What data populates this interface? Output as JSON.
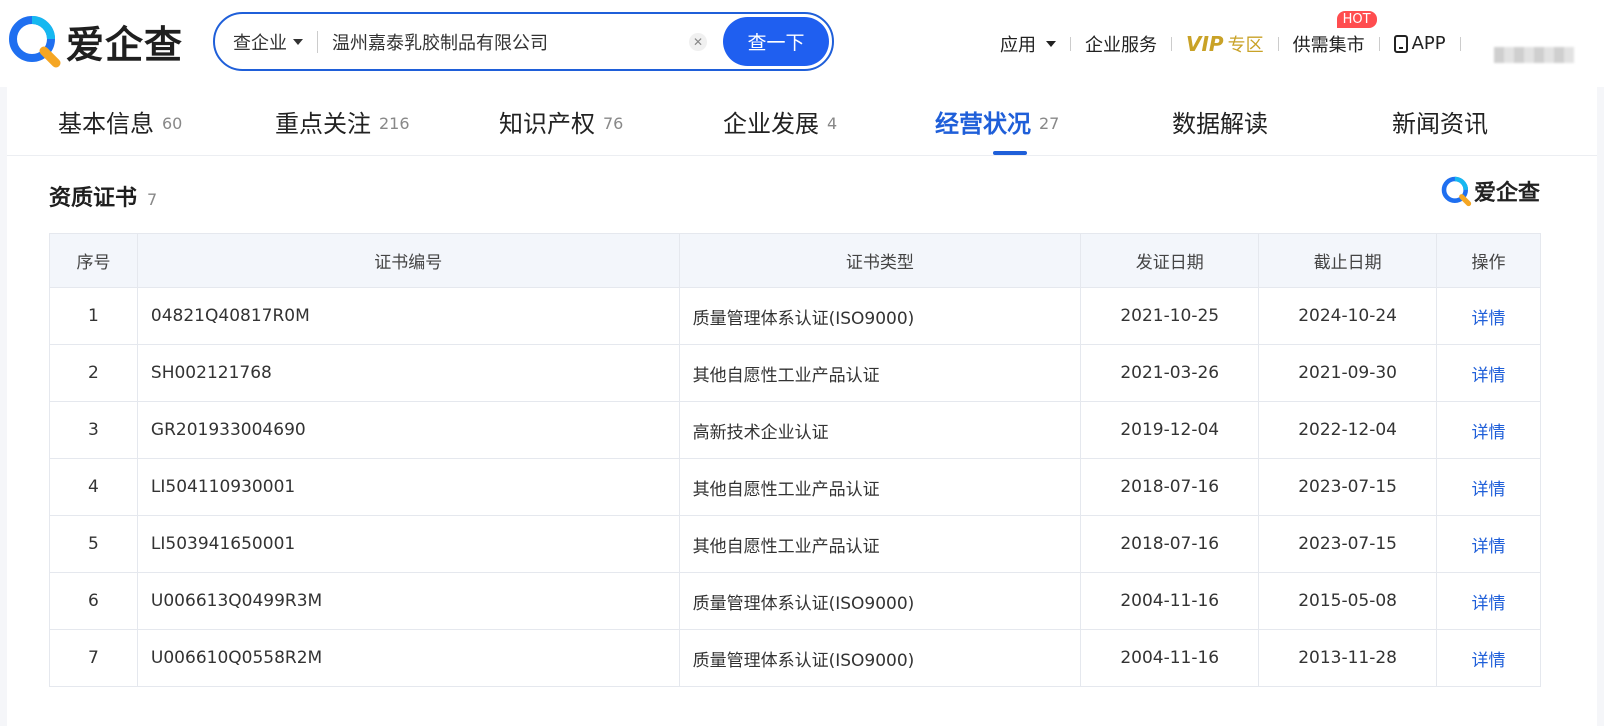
{
  "header": {
    "logo_text": "爱企查",
    "search": {
      "type_label": "查企业",
      "value": "温州嘉泰乳胶制品有限公司",
      "button_label": "查一下"
    },
    "nav": {
      "apps_label": "应用",
      "enterprise_service_label": "企业服务",
      "vip_label": "VIP",
      "vip_zone_label": "专区",
      "supply_label": "供需集市",
      "hot_badge": "HOT",
      "app_label": "APP"
    }
  },
  "tabs": [
    {
      "label": "基本信息",
      "count": "60"
    },
    {
      "label": "重点关注",
      "count": "216"
    },
    {
      "label": "知识产权",
      "count": "76"
    },
    {
      "label": "企业发展",
      "count": "4"
    },
    {
      "label": "经营状况",
      "count": "27"
    },
    {
      "label": "数据解读",
      "count": ""
    },
    {
      "label": "新闻资讯",
      "count": ""
    }
  ],
  "active_tab": "经营状况",
  "section": {
    "title": "资质证书",
    "count": "7",
    "watermark_text": "爱企查"
  },
  "table": {
    "columns": [
      "序号",
      "证书编号",
      "证书类型",
      "发证日期",
      "截止日期",
      "操作"
    ],
    "action_label": "详情",
    "rows": [
      {
        "idx": "1",
        "number": "04821Q40817R0M",
        "type": "质量管理体系认证(ISO9000)",
        "issue": "2021-10-25",
        "expire": "2024-10-24"
      },
      {
        "idx": "2",
        "number": "SH002121768",
        "type": "其他自愿性工业产品认证",
        "issue": "2021-03-26",
        "expire": "2021-09-30"
      },
      {
        "idx": "3",
        "number": "GR201933004690",
        "type": "高新技术企业认证",
        "issue": "2019-12-04",
        "expire": "2022-12-04"
      },
      {
        "idx": "4",
        "number": "LI504110930001",
        "type": "其他自愿性工业产品认证",
        "issue": "2018-07-16",
        "expire": "2023-07-15"
      },
      {
        "idx": "5",
        "number": "LI503941650001",
        "type": "其他自愿性工业产品认证",
        "issue": "2018-07-16",
        "expire": "2023-07-15"
      },
      {
        "idx": "6",
        "number": "U006613Q0499R3M",
        "type": "质量管理体系认证(ISO9000)",
        "issue": "2004-11-16",
        "expire": "2015-05-08"
      },
      {
        "idx": "7",
        "number": "U006610Q0558R2M",
        "type": "质量管理体系认证(ISO9000)",
        "issue": "2004-11-16",
        "expire": "2013-11-28"
      }
    ]
  },
  "colors": {
    "brand_blue": "#1f5fd9",
    "vip_gold": "#c9a227",
    "hot_red": "#ff4d4f"
  }
}
